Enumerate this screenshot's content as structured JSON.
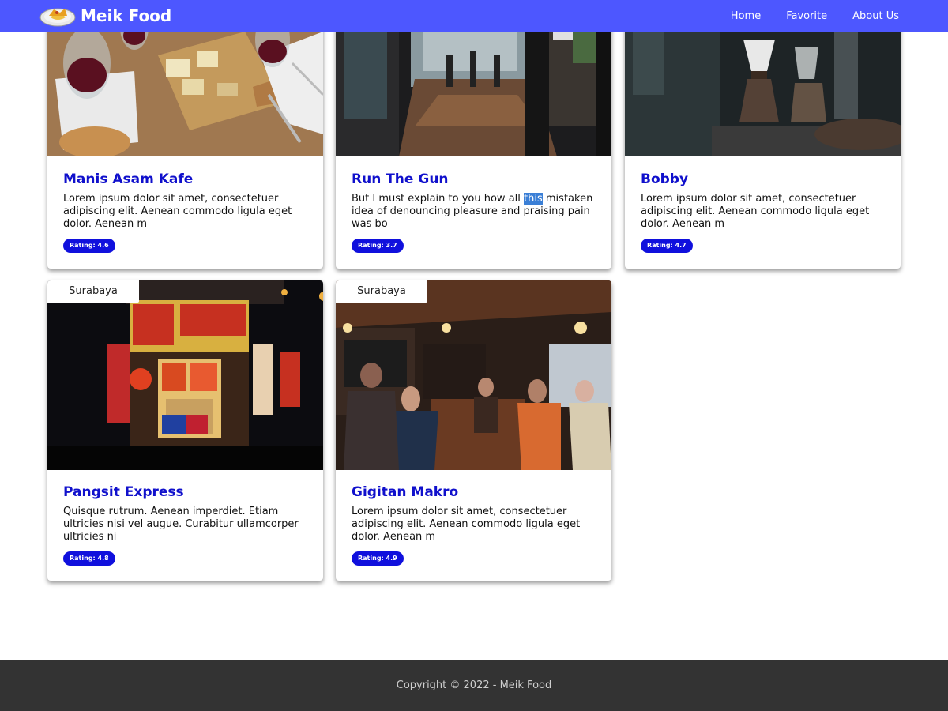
{
  "header": {
    "brand": "Meik Food",
    "logo_icon": "food-plate-logo-icon",
    "nav": [
      "Home",
      "Favorite",
      "About Us"
    ],
    "bg_color": "#4d57ff"
  },
  "cards": [
    {
      "title": "Manis Asam Kafe",
      "desc": "Lorem ipsum dolor sit amet, consectetuer adipiscing elit. Aenean commodo ligula eget dolor. Aenean m",
      "rating": "Rating: 4.6",
      "image": "wine-and-cheese-table-photo"
    },
    {
      "title": "Run The Gun",
      "desc_pre": "But I must explain to you how all ",
      "desc_hl": "this",
      "desc_post": " mistaken idea of denouncing pleasure and praising pain was bo",
      "rating": "Rating: 3.7",
      "image": "cafe-interior-photo"
    },
    {
      "title": "Bobby",
      "desc": "Lorem ipsum dolor sit amet, consectetuer adipiscing elit. Aenean commodo ligula eget dolor. Aenean m",
      "rating": "Rating: 4.7",
      "image": "coffee-brewing-bar-photo"
    },
    {
      "city": "Surabaya",
      "title": "Pangsit Express",
      "desc": "Quisque rutrum. Aenean imperdiet. Etiam ultricies nisi vel augue. Curabitur ullamcorper ultricies ni",
      "rating": "Rating: 4.8",
      "image": "ramen-shop-night-photo"
    },
    {
      "city": "Surabaya",
      "title": "Gigitan Makro",
      "desc": "Lorem ipsum dolor sit amet, consectetuer adipiscing elit. Aenean commodo ligula eget dolor. Aenean m",
      "rating": "Rating: 4.9",
      "image": "crowded-pub-photo"
    }
  ],
  "footer": {
    "text": "Copyright © 2022 - Meik Food"
  },
  "colors": {
    "title": "#1010cc",
    "badge": "#1010dd",
    "footer_bg": "#333333"
  }
}
